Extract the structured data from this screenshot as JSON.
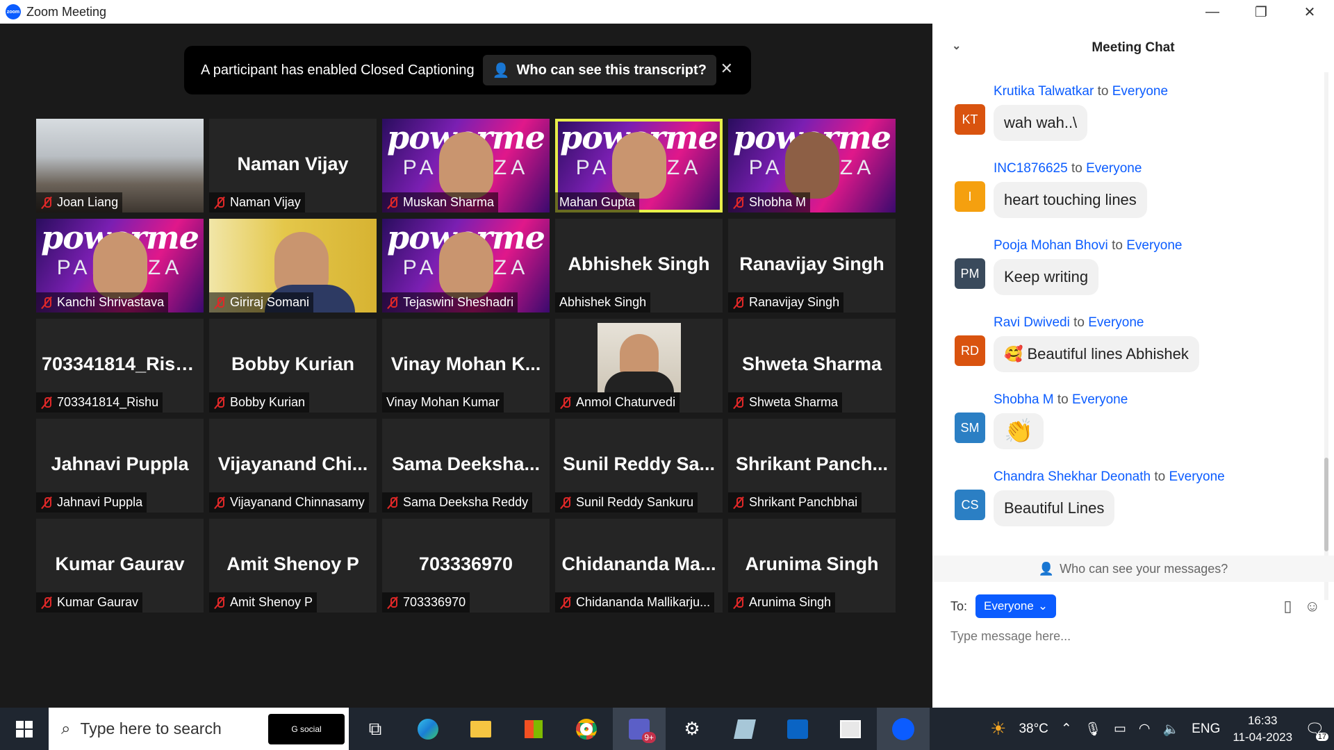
{
  "window": {
    "title": "Zoom Meeting",
    "logo_text": "zoom"
  },
  "banner": {
    "text": "A participant has enabled Closed Captioning",
    "button": "Who can see this transcript?"
  },
  "tiles": [
    {
      "big": "",
      "name": "Joan Liang",
      "muted": true,
      "bg": "office"
    },
    {
      "big": "Naman Vijay",
      "name": "Naman Vijay",
      "muted": true,
      "bg": "plain"
    },
    {
      "big": "",
      "name": "Muskan Sharma",
      "muted": true,
      "bg": "power"
    },
    {
      "big": "",
      "name": "Mahan Gupta",
      "muted": false,
      "bg": "power",
      "active": true
    },
    {
      "big": "",
      "name": "Shobha M",
      "muted": true,
      "bg": "power"
    },
    {
      "big": "",
      "name": "Kanchi Shrivastava",
      "muted": true,
      "bg": "power"
    },
    {
      "big": "",
      "name": "Giriraj Somani",
      "muted": true,
      "bg": "yellow"
    },
    {
      "big": "",
      "name": "Tejaswini Sheshadri",
      "muted": true,
      "bg": "power"
    },
    {
      "big": "Abhishek Singh",
      "name": "Abhishek Singh",
      "muted": false,
      "bg": "plain"
    },
    {
      "big": "Ranavijay Singh",
      "name": "Ranavijay Singh",
      "muted": true,
      "bg": "plain"
    },
    {
      "big": "703341814_Rishu",
      "name": "703341814_Rishu",
      "muted": true,
      "bg": "plain"
    },
    {
      "big": "Bobby Kurian",
      "name": "Bobby Kurian",
      "muted": true,
      "bg": "plain"
    },
    {
      "big": "Vinay Mohan K...",
      "name": "Vinay Mohan Kumar",
      "muted": false,
      "bg": "plain"
    },
    {
      "big": "",
      "name": "Anmol Chaturvedi",
      "muted": true,
      "bg": "photo"
    },
    {
      "big": "Shweta Sharma",
      "name": "Shweta Sharma",
      "muted": true,
      "bg": "plain"
    },
    {
      "big": "Jahnavi Puppla",
      "name": "Jahnavi Puppla",
      "muted": true,
      "bg": "plain"
    },
    {
      "big": "Vijayanand Chi...",
      "name": "Vijayanand Chinnasamy",
      "muted": true,
      "bg": "plain"
    },
    {
      "big": "Sama Deeksha...",
      "name": "Sama Deeksha Reddy",
      "muted": true,
      "bg": "plain"
    },
    {
      "big": "Sunil Reddy Sa...",
      "name": "Sunil Reddy Sankuru",
      "muted": true,
      "bg": "plain"
    },
    {
      "big": "Shrikant Panch...",
      "name": "Shrikant Panchbhai",
      "muted": true,
      "bg": "plain"
    },
    {
      "big": "Kumar Gaurav",
      "name": "Kumar Gaurav",
      "muted": true,
      "bg": "plain"
    },
    {
      "big": "Amit Shenoy P",
      "name": "Amit Shenoy P",
      "muted": true,
      "bg": "plain"
    },
    {
      "big": "703336970",
      "name": "703336970",
      "muted": true,
      "bg": "plain"
    },
    {
      "big": "Chidananda Ma...",
      "name": "Chidananda Mallikarju...",
      "muted": true,
      "bg": "plain"
    },
    {
      "big": "Arunima Singh",
      "name": "Arunima Singh",
      "muted": true,
      "bg": "plain"
    }
  ],
  "power_text": {
    "top": "powerme",
    "bottom": "PALOOZA"
  },
  "chat": {
    "title": "Meeting Chat",
    "messages": [
      {
        "initials": "KT",
        "color": "#d9530f",
        "from": "Krutika Talwatkar",
        "to": "Everyone",
        "text": "wah wah..\\"
      },
      {
        "initials": "I",
        "color": "#f5a00f",
        "from": "INC1876625",
        "to": "Everyone",
        "text": "heart touching lines"
      },
      {
        "initials": "PM",
        "color": "#3a4a5c",
        "from": "Pooja Mohan Bhovi",
        "to": "Everyone",
        "text": "Keep writing"
      },
      {
        "initials": "RD",
        "color": "#d9530f",
        "from": "Ravi Dwivedi",
        "to": "Everyone",
        "text": "🥰 Beautiful lines Abhishek"
      },
      {
        "initials": "SM",
        "color": "#2b7fc4",
        "from": "Shobha M",
        "to": "Everyone",
        "text": "👏"
      },
      {
        "initials": "CS",
        "color": "#2b7fc4",
        "from": "Chandra Shekhar Deonath",
        "to": "Everyone",
        "text": "Beautiful Lines"
      }
    ],
    "to_word": "to",
    "who_can_see": "Who can see your messages?",
    "to_label": "To:",
    "recipient": "Everyone",
    "placeholder": "Type message here..."
  },
  "taskbar": {
    "search_placeholder": "Type here to search",
    "search_badge": "G social",
    "teams_badge": "9+",
    "weather": "38°C",
    "lang": "ENG",
    "time": "16:33",
    "date": "11-04-2023",
    "notifications": "17"
  }
}
